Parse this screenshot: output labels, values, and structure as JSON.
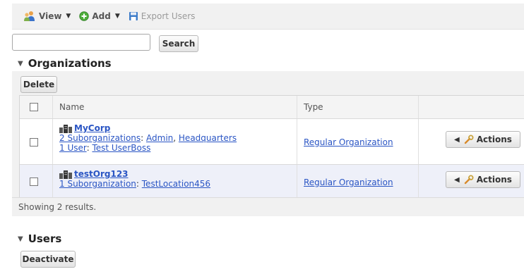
{
  "toolbar": {
    "view_label": "View",
    "add_label": "Add",
    "export_label": "Export Users"
  },
  "search": {
    "value": "",
    "placeholder": "",
    "button_label": "Search"
  },
  "organizations": {
    "section_title": "Organizations",
    "delete_label": "Delete",
    "columns": [
      "Name",
      "Type"
    ],
    "rows": [
      {
        "name": "MyCorp",
        "sub_count_label": "2 Suborganizations",
        "subs": [
          "Admin",
          "Headquarters"
        ],
        "user_count_label": "1 User",
        "user_name": "Test UserBoss",
        "type": "Regular Organization",
        "actions_label": "Actions"
      },
      {
        "name": "testOrg123",
        "sub_count_label": "1 Suborganization",
        "subs": [
          "TestLocation456"
        ],
        "type": "Regular Organization",
        "actions_label": "Actions"
      }
    ],
    "results_text": "Showing 2 results."
  },
  "users": {
    "section_title": "Users",
    "deactivate_label": "Deactivate"
  },
  "icons": {
    "view": "users-icon",
    "add": "add-circle-icon",
    "export": "save-disk-icon",
    "org": "organization-icon",
    "actions": "wrench-icon"
  },
  "colors": {
    "link": "#2a55c4",
    "panel": "#f1f1f1",
    "selected_row": "#eef0f9"
  }
}
